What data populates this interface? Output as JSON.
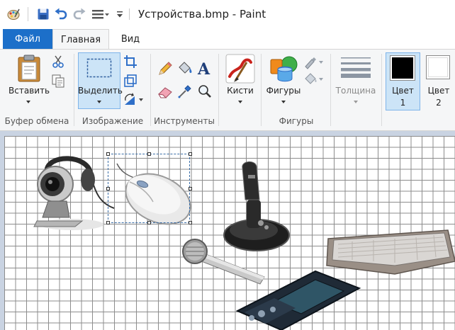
{
  "window": {
    "title": "Устройства.bmp - Paint"
  },
  "tabs": [
    {
      "label": "Файл"
    },
    {
      "label": "Главная"
    },
    {
      "label": "Вид"
    }
  ],
  "ribbon": {
    "clipboard": {
      "paste_label": "Вставить",
      "group_label": "Буфер обмена"
    },
    "image": {
      "select_label": "Выделить",
      "group_label": "Изображение"
    },
    "tools": {
      "group_label": "Инструменты"
    },
    "brushes": {
      "label": "Кисти"
    },
    "shapes": {
      "label": "Фигуры",
      "group_label": "Фигуры"
    },
    "size": {
      "label": "Толщина"
    },
    "color1": {
      "label_line1": "Цвет",
      "label_line2": "1",
      "value": "#000000"
    },
    "color2": {
      "label_line1": "Цвет",
      "label_line2": "2",
      "value": "#ffffff"
    }
  },
  "colors": {
    "file_tab": "#1c6fc9",
    "selection": "#cce4f7",
    "workspace": "#c9d3e2"
  },
  "icons": [
    "paint-app-icon",
    "save-icon",
    "undo-icon",
    "redo-icon",
    "customize-icon",
    "paste-icon",
    "cut-icon",
    "copy-icon",
    "select-icon",
    "crop-icon",
    "resize-icon",
    "rotate-icon",
    "pencil-icon",
    "fill-icon",
    "text-icon",
    "eraser-icon",
    "color-picker-icon",
    "magnifier-icon",
    "brushes-icon",
    "shapes-icon",
    "outline-icon",
    "fill-shape-icon",
    "size-icon"
  ]
}
